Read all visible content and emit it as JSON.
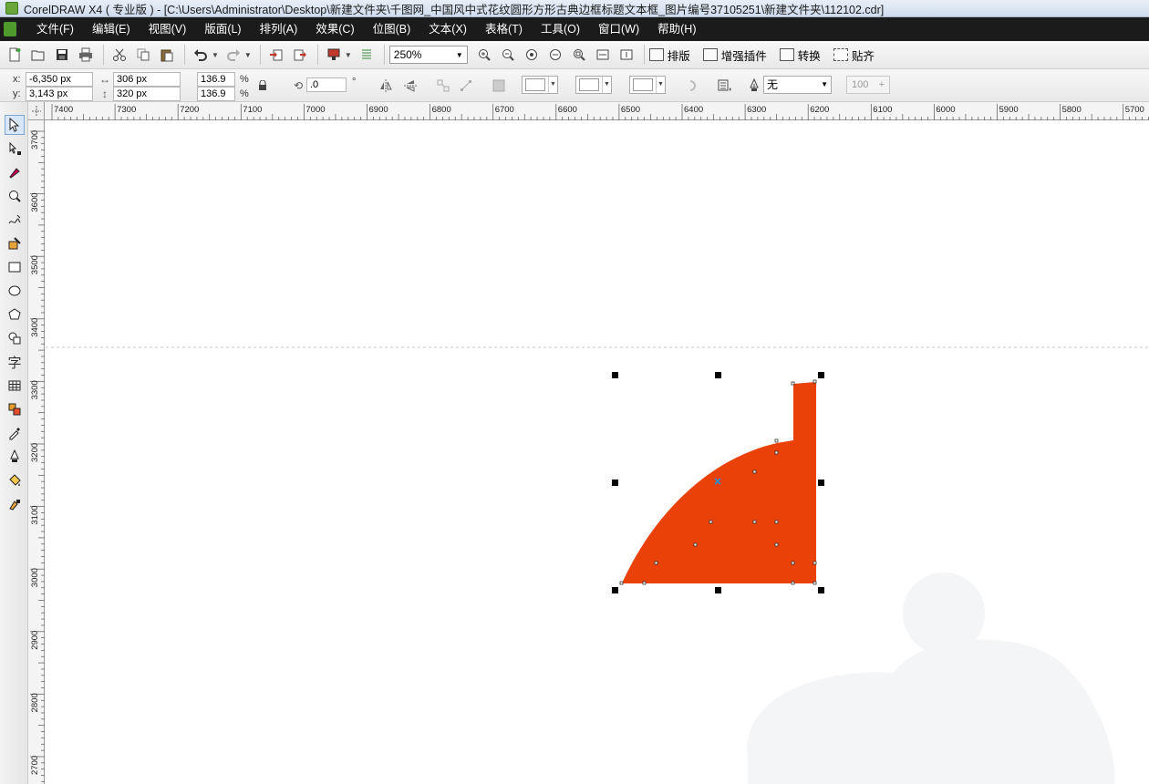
{
  "window": {
    "title": "CorelDRAW X4 ( 专业版 ) - [C:\\Users\\Administrator\\Desktop\\新建文件夹\\千图网_中国风中式花纹圆形方形古典边框标题文本框_图片编号37105251\\新建文件夹\\112102.cdr]"
  },
  "menu": {
    "items": [
      {
        "label": "文件(F)"
      },
      {
        "label": "编辑(E)"
      },
      {
        "label": "视图(V)"
      },
      {
        "label": "版面(L)"
      },
      {
        "label": "排列(A)"
      },
      {
        "label": "效果(C)"
      },
      {
        "label": "位图(B)"
      },
      {
        "label": "文本(X)"
      },
      {
        "label": "表格(T)"
      },
      {
        "label": "工具(O)"
      },
      {
        "label": "窗口(W)"
      },
      {
        "label": "帮助(H)"
      }
    ]
  },
  "toolbar": {
    "zoom_value": "250%",
    "layout_label": "排版",
    "plugins_label": "增强插件",
    "convert_label": "转换",
    "snap_label": "贴齐"
  },
  "propbar": {
    "x_label": "x:",
    "y_label": "y:",
    "x_value": "-6,350 px",
    "y_value": "3,143 px",
    "width_value": "306 px",
    "height_value": "320 px",
    "scale_x": "136.9",
    "scale_y": "136.9",
    "percent": "%",
    "rotation": ".0",
    "degree": "°",
    "outline_label": "无",
    "opacity_value": "100"
  },
  "rulers": {
    "top_ticks": [
      "7400",
      "7300",
      "7200",
      "7100",
      "7000",
      "6900",
      "6800",
      "6700",
      "6600",
      "6500",
      "6400",
      "6300",
      "6200",
      "6100",
      "6000",
      "5900",
      "5800",
      "5700"
    ],
    "left_ticks": [
      "3700",
      "3600",
      "3500",
      "3400",
      "3300",
      "3200",
      "3100",
      "3000",
      "2900",
      "2800",
      "2700"
    ]
  },
  "canvas": {
    "shape_fill": "#ea4109",
    "selection_handle_color": "#000000",
    "guide_color": "#c8c8c8"
  },
  "colors": {
    "menubar_bg": "#1b1b1b",
    "menubar_text": "#ffffff",
    "shape_orange": "#ea4109"
  }
}
